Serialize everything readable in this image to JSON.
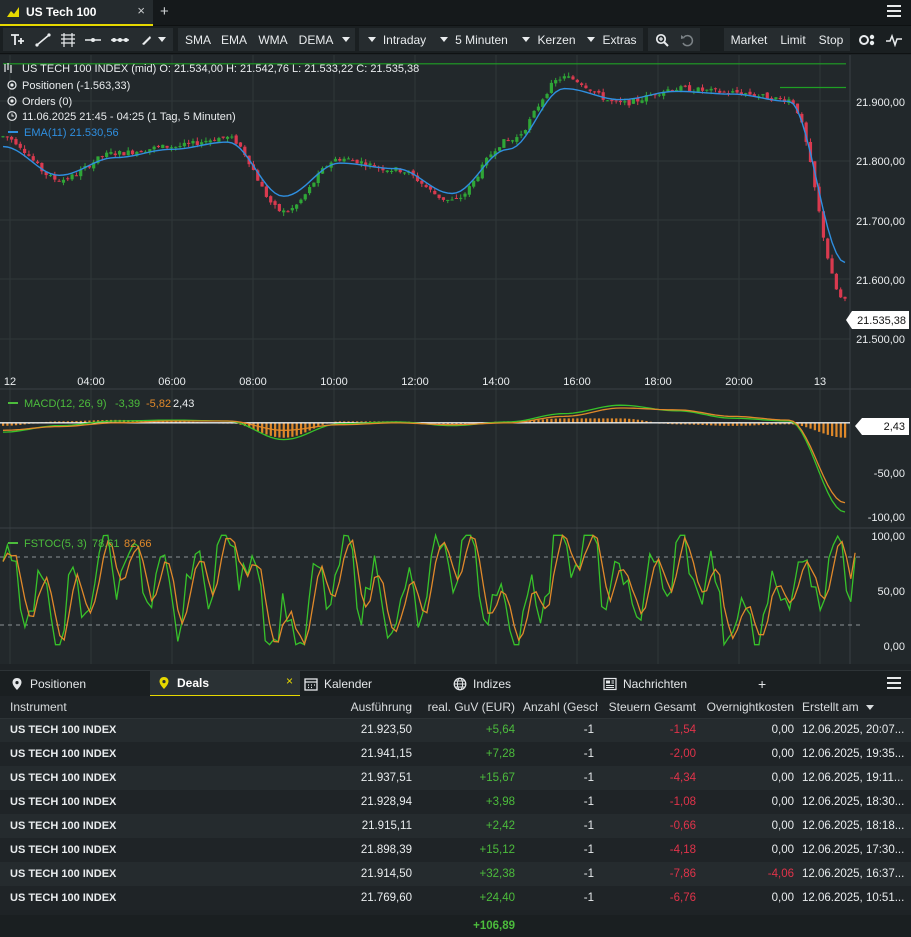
{
  "window": {
    "tab_title": "US Tech 100",
    "add_tab": "+",
    "close": "×"
  },
  "toolbar": {
    "indicators": [
      "SMA",
      "EMA",
      "WMA",
      "DEMA"
    ],
    "interval_group": "Intraday",
    "interval": "5 Minuten",
    "chart_type": "Kerzen",
    "extras": "Extras",
    "order_types": [
      "Market",
      "Limit",
      "Stop"
    ]
  },
  "chart_info": {
    "ohlc_line": "US TECH 100 INDEX (mid)  O: 21.534,00  H: 21.542,76  L: 21.533,22  C: 21.535,38",
    "positions": "Positionen (-1.563,33)",
    "orders": "Orders (0)",
    "time_range": "11.06.2025 21:45 - 04:25  (1 Tag, 5 Minuten)",
    "ema_label": "EMA(11)  21.530,56"
  },
  "price_axis": {
    "ticks": [
      "21.900,00",
      "21.800,00",
      "21.700,00",
      "21.600,00",
      "21.500,00"
    ],
    "last_price": "21.535,38",
    "time_ticks": [
      "12",
      "04:00",
      "06:00",
      "08:00",
      "10:00",
      "12:00",
      "14:00",
      "16:00",
      "18:00",
      "20:00",
      "13"
    ]
  },
  "macd": {
    "label": "MACD(12, 26, 9)",
    "v1": "-3,39",
    "v2": "-5,82",
    "v3": "2,43",
    "axis_value": "2,43",
    "ticks": [
      "-50,00",
      "-100,00"
    ]
  },
  "fstoc": {
    "label": "FSTOC(5, 3)",
    "v1": "78,61",
    "v2": "82,66",
    "ticks": [
      "100,00",
      "50,00",
      "0,00"
    ]
  },
  "colors": {
    "up": "#2fa637",
    "down": "#d93a4f",
    "ema": "#2f8fe0",
    "signal": "#e0892a",
    "accent": "#e6d800"
  },
  "panel": {
    "tabs": [
      "Positionen",
      "Deals",
      "Kalender",
      "Indizes",
      "Nachrichten",
      "+"
    ],
    "columns": [
      "Instrument",
      "Ausführung",
      "real. GuV (EUR)",
      "Anzahl (Geschl",
      "Steuern Gesamt",
      "Overnightkosten",
      "Erstellt am"
    ],
    "rows": [
      {
        "instrument": "US TECH 100 INDEX",
        "exec": "21.923,50",
        "pnl": "+5,64",
        "qty": "-1",
        "tax": "-1,54",
        "overnight": "0,00",
        "overnight_neg": false,
        "created": "12.06.2025, 20:07..."
      },
      {
        "instrument": "US TECH 100 INDEX",
        "exec": "21.941,15",
        "pnl": "+7,28",
        "qty": "-1",
        "tax": "-2,00",
        "overnight": "0,00",
        "overnight_neg": false,
        "created": "12.06.2025, 19:35..."
      },
      {
        "instrument": "US TECH 100 INDEX",
        "exec": "21.937,51",
        "pnl": "+15,67",
        "qty": "-1",
        "tax": "-4,34",
        "overnight": "0,00",
        "overnight_neg": false,
        "created": "12.06.2025, 19:11..."
      },
      {
        "instrument": "US TECH 100 INDEX",
        "exec": "21.928,94",
        "pnl": "+3,98",
        "qty": "-1",
        "tax": "-1,08",
        "overnight": "0,00",
        "overnight_neg": false,
        "created": "12.06.2025, 18:30..."
      },
      {
        "instrument": "US TECH 100 INDEX",
        "exec": "21.915,11",
        "pnl": "+2,42",
        "qty": "-1",
        "tax": "-0,66",
        "overnight": "0,00",
        "overnight_neg": false,
        "created": "12.06.2025, 18:18..."
      },
      {
        "instrument": "US TECH 100 INDEX",
        "exec": "21.898,39",
        "pnl": "+15,12",
        "qty": "-1",
        "tax": "-4,18",
        "overnight": "0,00",
        "overnight_neg": false,
        "created": "12.06.2025, 17:30..."
      },
      {
        "instrument": "US TECH 100 INDEX",
        "exec": "21.914,50",
        "pnl": "+32,38",
        "qty": "-1",
        "tax": "-7,86",
        "overnight": "-4,06",
        "overnight_neg": true,
        "created": "12.06.2025, 16:37..."
      },
      {
        "instrument": "US TECH 100 INDEX",
        "exec": "21.769,60",
        "pnl": "+24,40",
        "qty": "-1",
        "tax": "-6,76",
        "overnight": "0,00",
        "overnight_neg": false,
        "created": "12.06.2025, 10:51..."
      }
    ],
    "total": "+106,89"
  },
  "chart_data": [
    {
      "type": "line",
      "title": "US TECH 100 INDEX (mid)",
      "ylabel": "",
      "ylim": [
        21475,
        21975
      ],
      "x": [
        "12",
        "04:00",
        "06:00",
        "08:00",
        "10:00",
        "12:00",
        "14:00",
        "16:00",
        "18:00",
        "20:00",
        "13"
      ],
      "series": [
        {
          "name": "",
          "values": [
            21838,
            21760,
            21808,
            21820,
            21836,
            21702,
            21798,
            21778,
            21722,
            21830,
            21945,
            21898,
            21925,
            21918,
            21905,
            21540
          ]
        },
        {
          "name": "EMA(11)",
          "values": [
            21820,
            21768,
            21800,
            21815,
            21828,
            21730,
            21790,
            21780,
            21735,
            21815,
            21925,
            21905,
            21920,
            21915,
            21902,
            21610
          ]
        }
      ]
    },
    {
      "type": "line",
      "title": "MACD(12, 26, 9)",
      "ylim": [
        -110,
        30
      ],
      "series": [
        {
          "name": "",
          "values": [
            -10,
            -3,
            2,
            3,
            2,
            -18,
            -1,
            1,
            -3,
            1,
            10,
            19,
            13,
            5,
            2,
            -96
          ]
        },
        {
          "name": "",
          "values": [
            -8,
            -4,
            0,
            2,
            2,
            -8,
            -2,
            0,
            -2,
            0,
            7,
            16,
            14,
            7,
            3,
            -86
          ]
        }
      ]
    },
    {
      "type": "line",
      "title": "FSTOC(5, 3)",
      "ylim": [
        0,
        100
      ],
      "series": [
        {
          "name": "",
          "values": [
            65,
            25,
            80,
            40,
            90,
            10,
            70,
            30,
            85,
            20,
            95,
            45,
            75,
            15,
            60,
            79
          ]
        },
        {
          "name": "",
          "values": [
            60,
            35,
            70,
            45,
            80,
            20,
            65,
            35,
            78,
            28,
            88,
            50,
            70,
            22,
            55,
            83
          ]
        }
      ]
    }
  ]
}
